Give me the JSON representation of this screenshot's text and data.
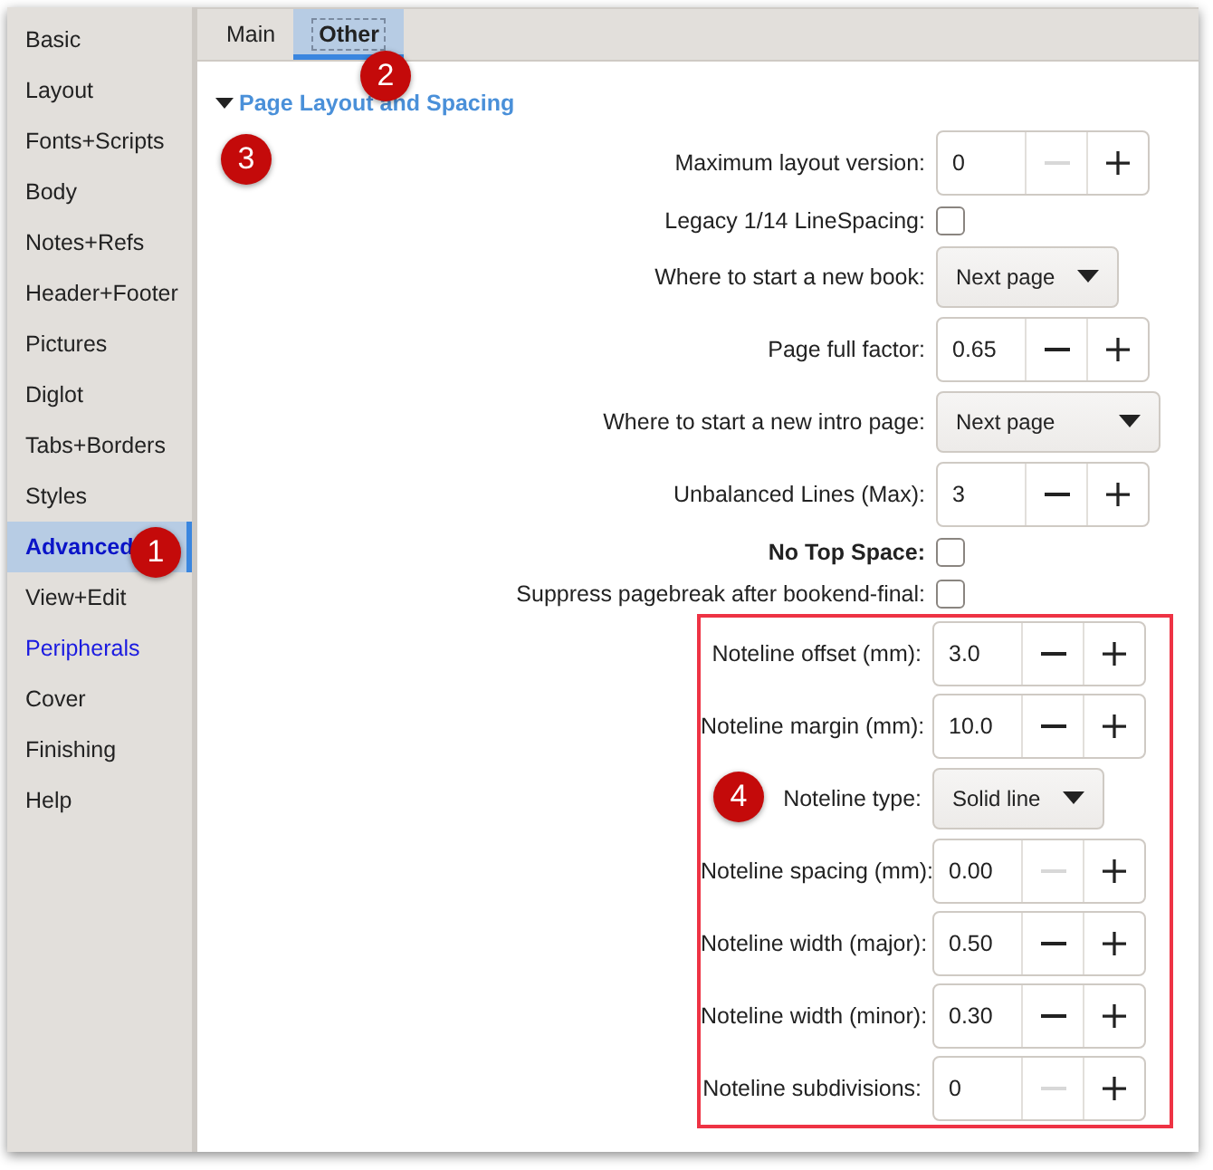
{
  "sidebar": {
    "items": [
      {
        "label": "Basic",
        "selected": false,
        "highlighted": false
      },
      {
        "label": "Layout",
        "selected": false,
        "highlighted": false
      },
      {
        "label": "Fonts+Scripts",
        "selected": false,
        "highlighted": false
      },
      {
        "label": "Body",
        "selected": false,
        "highlighted": false
      },
      {
        "label": "Notes+Refs",
        "selected": false,
        "highlighted": false
      },
      {
        "label": "Header+Footer",
        "selected": false,
        "highlighted": false
      },
      {
        "label": "Pictures",
        "selected": false,
        "highlighted": false
      },
      {
        "label": "Diglot",
        "selected": false,
        "highlighted": false
      },
      {
        "label": "Tabs+Borders",
        "selected": false,
        "highlighted": false
      },
      {
        "label": "Styles",
        "selected": false,
        "highlighted": false
      },
      {
        "label": "Advanced",
        "selected": true,
        "highlighted": false
      },
      {
        "label": "View+Edit",
        "selected": false,
        "highlighted": false
      },
      {
        "label": "Peripherals",
        "selected": false,
        "highlighted": true
      },
      {
        "label": "Cover",
        "selected": false,
        "highlighted": false
      },
      {
        "label": "Finishing",
        "selected": false,
        "highlighted": false
      },
      {
        "label": "Help",
        "selected": false,
        "highlighted": false
      }
    ]
  },
  "tabs": [
    {
      "label": "Main",
      "selected": false
    },
    {
      "label": "Other",
      "selected": true
    }
  ],
  "section": {
    "title": "Page Layout and Spacing",
    "expanded": true
  },
  "rows": [
    {
      "kind": "spin",
      "label": "Maximum layout version:",
      "value": "0",
      "minus_disabled": true
    },
    {
      "kind": "check",
      "label": "Legacy 1/14 LineSpacing:",
      "checked": false
    },
    {
      "kind": "combo",
      "label": "Where to start a new book:",
      "value": "Next page"
    },
    {
      "kind": "spin",
      "label": "Page full factor:",
      "value": "0.65",
      "minus_disabled": false
    },
    {
      "kind": "combo",
      "label": "Where to start a new intro page:",
      "value": "Next page",
      "wide": true
    },
    {
      "kind": "spin",
      "label": "Unbalanced Lines (Max):",
      "value": "3",
      "minus_disabled": false
    },
    {
      "kind": "check",
      "label": "No Top Space:",
      "checked": false,
      "bold": true
    },
    {
      "kind": "check",
      "label": "Suppress pagebreak after bookend-final:",
      "checked": false
    }
  ],
  "highlight_group": {
    "rows": [
      {
        "kind": "spin",
        "label": "Noteline offset (mm):",
        "value": "3.0",
        "minus_disabled": false
      },
      {
        "kind": "spin",
        "label": "Noteline margin (mm):",
        "value": "10.0",
        "minus_disabled": false
      },
      {
        "kind": "combo",
        "label": "Noteline type:",
        "value": "Solid line"
      },
      {
        "kind": "spin",
        "label": "Noteline spacing (mm):",
        "value": "0.00",
        "minus_disabled": true
      },
      {
        "kind": "spin",
        "label": "Noteline width (major):",
        "value": "0.50",
        "minus_disabled": false
      },
      {
        "kind": "spin",
        "label": "Noteline width (minor):",
        "value": "0.30",
        "minus_disabled": false
      },
      {
        "kind": "spin",
        "label": "Noteline subdivisions:",
        "value": "0",
        "minus_disabled": true
      }
    ]
  },
  "callouts": [
    {
      "label": "1"
    },
    {
      "label": "2"
    },
    {
      "label": "3"
    },
    {
      "label": "4"
    }
  ]
}
